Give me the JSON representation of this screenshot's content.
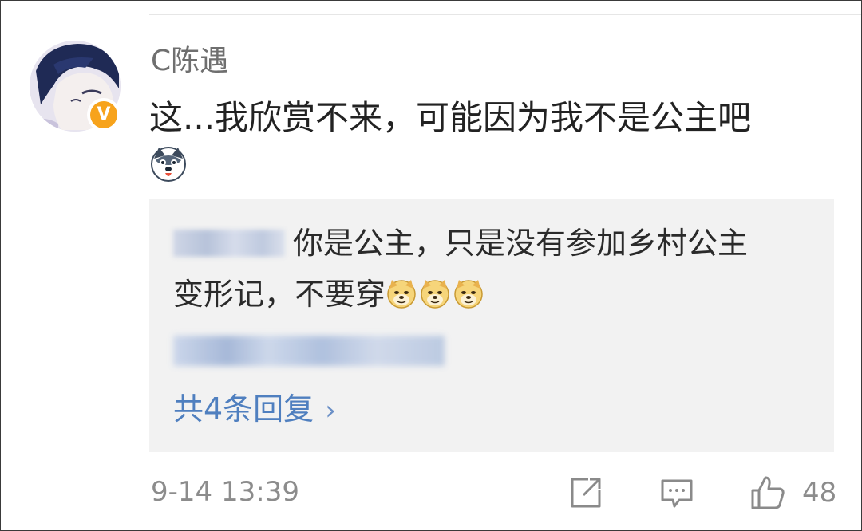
{
  "comment": {
    "username": "C陈遇",
    "verified_badge": "V",
    "text": "这...我欣赏不来，可能因为我不是公主吧",
    "emoji": "husky-emoji"
  },
  "reply_box": {
    "reply_text_line1": "你是公主，只是没有参加乡村公主",
    "reply_text_line2": "变形记，不要穿",
    "reply_emojis": [
      "doge-emoji",
      "doge-emoji",
      "doge-emoji"
    ],
    "total_replies_label": "共4条回复",
    "chevron": "›"
  },
  "footer": {
    "timestamp": "9-14 13:39",
    "like_count": "48"
  },
  "colors": {
    "link_blue": "#4f7fbf",
    "badge_orange": "#f7a31c",
    "reply_bg": "#f2f2f2"
  }
}
